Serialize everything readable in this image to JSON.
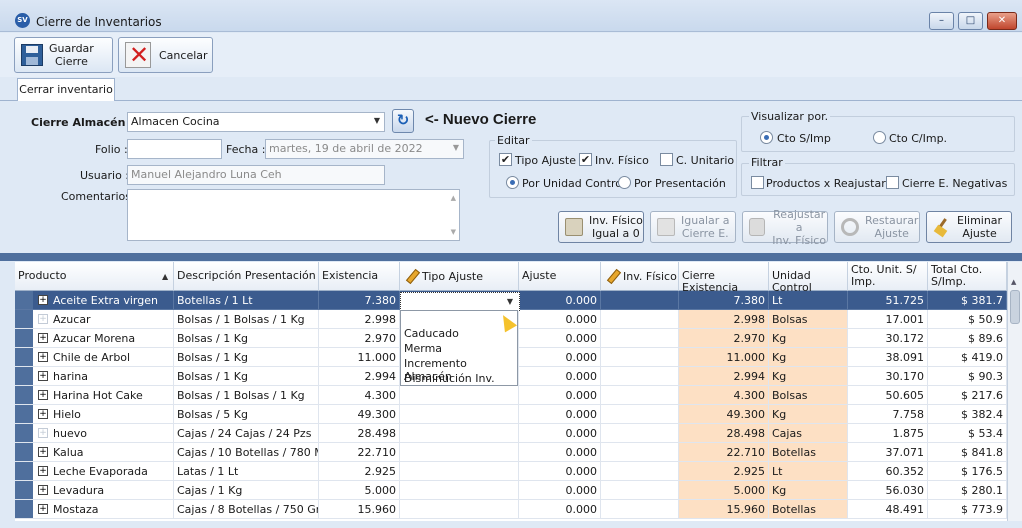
{
  "window": {
    "title": "Cierre de Inventarios",
    "icon": "app-icon",
    "icon_text": "SV",
    "min": "–",
    "max": "□",
    "close": "✕"
  },
  "toolbar": {
    "save": {
      "label_top": "Guardar",
      "label_bottom": "Cierre",
      "icon": "save-icon"
    },
    "cancel": {
      "label": "Cancelar",
      "icon": "cancel-icon"
    }
  },
  "tabs": [
    {
      "label": "Cerrar inventario"
    }
  ],
  "form": {
    "almacen_label": "Cierre Almacén :",
    "almacen_value": "Almacen Cocina",
    "refresh_icon": "↻",
    "nuevo_cierre": "<- Nuevo Cierre",
    "folio_label": "Folio :",
    "folio_value": "",
    "fecha_label": "Fecha :",
    "fecha_value": "martes, 19 de abril de 2022",
    "usuario_label": "Usuario :",
    "usuario_value": "Manuel Alejandro  Luna Ceh",
    "comentarios_label": "Comentarios",
    "comentarios_value": ""
  },
  "editar": {
    "title": "Editar",
    "tipo_ajuste": {
      "label": "Tipo Ajuste",
      "checked": true
    },
    "inv_fisico": {
      "label": "Inv. Físico",
      "checked": true
    },
    "c_unitario": {
      "label": "C. Unitario",
      "checked": false
    },
    "por_unidad": {
      "label": "Por Unidad Control",
      "selected": true
    },
    "por_presentacion": {
      "label": "Por Presentación",
      "selected": false
    }
  },
  "visualizar": {
    "title": "Visualizar por.",
    "cto_simp": {
      "label": "Cto S/Imp",
      "selected": true
    },
    "cto_cimp": {
      "label": "Cto C/Imp.",
      "selected": false
    }
  },
  "filtrar": {
    "title": "Filtrar",
    "productos_reajustar": {
      "label": "Productos x Reajustar",
      "checked": false
    },
    "cierre_negativas": {
      "label": "Cierre E. Negativas",
      "checked": false
    }
  },
  "actions": [
    {
      "top": "Inv. Físico",
      "bottom": "Igual a 0",
      "icon": "scale-icon",
      "enabled": true
    },
    {
      "top": "Igualar a",
      "bottom": "Cierre E.",
      "icon": "equalize-icon",
      "enabled": false
    },
    {
      "top": "Reajustar a",
      "bottom": "Inv. Físico",
      "icon": "readjust-icon",
      "enabled": false
    },
    {
      "top": "Restaurar",
      "bottom": "Ajuste",
      "icon": "restore-icon",
      "enabled": false
    },
    {
      "top": "Eliminar",
      "bottom": "Ajuste",
      "icon": "broom-icon",
      "enabled": true
    }
  ],
  "grid": {
    "columns": {
      "producto": "Producto",
      "descripcion": "Descripción Presentación",
      "existencia": "Existencia",
      "tipo_ajuste": "Tipo Ajuste",
      "ajuste": "Ajuste",
      "inv_fisico": "Inv. Físico",
      "cierre_existencia": "Cierre Existencia",
      "unidad_control": "Unidad Control",
      "cto_unit_1": "Cto. Unit. S/",
      "cto_unit_2": "Imp.",
      "total_cto_1": "Total Cto.",
      "total_cto_2": "S/Imp."
    },
    "rows": [
      {
        "producto": "Aceite Extra virgen",
        "expander": "+",
        "descripcion": "Botellas / 1 Lt",
        "existencia": "7.380",
        "tipo_ajuste": "",
        "ajuste": "0.000",
        "inv_fisico": "",
        "cierre": "7.380",
        "unidad": "Lt",
        "cto": "51.725",
        "total": "$ 381.7"
      },
      {
        "producto": "Azucar",
        "expander": "+",
        "descripcion": "Bolsas / 1 Bolsas / 1 Kg",
        "existencia": "2.998",
        "tipo_ajuste": "",
        "ajuste": "0.000",
        "inv_fisico": "",
        "cierre": "2.998",
        "unidad": "Bolsas",
        "cto": "17.001",
        "total": "$ 50.9"
      },
      {
        "producto": "Azucar Morena",
        "expander": "+",
        "descripcion": "Bolsas / 1 Kg",
        "existencia": "2.970",
        "tipo_ajuste": "",
        "ajuste": "0.000",
        "inv_fisico": "",
        "cierre": "2.970",
        "unidad": "Kg",
        "cto": "30.172",
        "total": "$ 89.6"
      },
      {
        "producto": "Chile de Arbol",
        "expander": "+",
        "descripcion": "Bolsas / 1 Kg",
        "existencia": "11.000",
        "tipo_ajuste": "",
        "ajuste": "0.000",
        "inv_fisico": "",
        "cierre": "11.000",
        "unidad": "Kg",
        "cto": "38.091",
        "total": "$ 419.0"
      },
      {
        "producto": "harina",
        "expander": "+",
        "descripcion": "Bolsas / 1 Kg",
        "existencia": "2.994",
        "tipo_ajuste": "",
        "ajuste": "0.000",
        "inv_fisico": "",
        "cierre": "2.994",
        "unidad": "Kg",
        "cto": "30.170",
        "total": "$ 90.3"
      },
      {
        "producto": "Harina Hot Cake",
        "expander": "+",
        "descripcion": "Bolsas / 1 Bolsas / 1 Kg",
        "existencia": "4.300",
        "tipo_ajuste": "",
        "ajuste": "0.000",
        "inv_fisico": "",
        "cierre": "4.300",
        "unidad": "Bolsas",
        "cto": "50.605",
        "total": "$ 217.6"
      },
      {
        "producto": "Hielo",
        "expander": "+",
        "descripcion": "Bolsas / 5 Kg",
        "existencia": "49.300",
        "tipo_ajuste": "",
        "ajuste": "0.000",
        "inv_fisico": "",
        "cierre": "49.300",
        "unidad": "Kg",
        "cto": "7.758",
        "total": "$ 382.4"
      },
      {
        "producto": "huevo",
        "expander": "+",
        "descripcion": "Cajas / 24 Cajas / 24 Pzs",
        "existencia": "28.498",
        "tipo_ajuste": "",
        "ajuste": "0.000",
        "inv_fisico": "",
        "cierre": "28.498",
        "unidad": "Cajas",
        "cto": "1.875",
        "total": "$ 53.4"
      },
      {
        "producto": "Kalua",
        "expander": "+",
        "descripcion": "Cajas / 10 Botellas / 780 ML",
        "existencia": "22.710",
        "tipo_ajuste": "",
        "ajuste": "0.000",
        "inv_fisico": "",
        "cierre": "22.710",
        "unidad": "Botellas",
        "cto": "37.071",
        "total": "$ 841.8"
      },
      {
        "producto": "Leche Evaporada",
        "expander": "+",
        "descripcion": "Latas / 1 Lt",
        "existencia": "2.925",
        "tipo_ajuste": "",
        "ajuste": "0.000",
        "inv_fisico": "",
        "cierre": "2.925",
        "unidad": "Lt",
        "cto": "60.352",
        "total": "$ 176.5"
      },
      {
        "producto": "Levadura",
        "expander": "+",
        "descripcion": "Cajas / 1 Kg",
        "existencia": "5.000",
        "tipo_ajuste": "",
        "ajuste": "0.000",
        "inv_fisico": "",
        "cierre": "5.000",
        "unidad": "Kg",
        "cto": "56.030",
        "total": "$ 280.1"
      },
      {
        "producto": "Mostaza",
        "expander": "+",
        "descripcion": "Cajas / 8 Botellas / 750 Gr",
        "existencia": "15.960",
        "tipo_ajuste": "",
        "ajuste": "0.000",
        "inv_fisico": "",
        "cierre": "15.960",
        "unidad": "Botellas",
        "cto": "48.491",
        "total": "$ 773.9"
      }
    ],
    "dropdown_options": [
      "Caducado",
      "Merma",
      "Incremento Almacén",
      "Disminución Inv."
    ]
  },
  "colors": {
    "selected_row": "#3b5b8e",
    "peach": "#fde0c4",
    "header_bar": "#4f6f9d"
  }
}
